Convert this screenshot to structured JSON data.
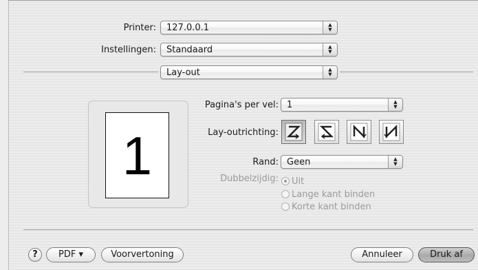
{
  "printer": {
    "label": "Printer:",
    "value": "127.0.0.1"
  },
  "settings": {
    "label": "Instellingen:",
    "value": "Standaard"
  },
  "panel": {
    "value": "Lay-out"
  },
  "preview": {
    "page_number": "1"
  },
  "pages_per_sheet": {
    "label": "Pagina's per vel:",
    "value": "1"
  },
  "layout_direction": {
    "label": "Lay-outrichting:",
    "options": [
      {
        "icon": "z-order-icon",
        "selected": true
      },
      {
        "icon": "reverse-z-order-icon",
        "selected": false
      },
      {
        "icon": "n-order-icon",
        "selected": false
      },
      {
        "icon": "reverse-n-order-icon",
        "selected": false
      }
    ]
  },
  "border": {
    "label": "Rand:",
    "value": "Geen"
  },
  "duplex": {
    "label": "Dubbelzijdig:",
    "enabled": false,
    "options": [
      {
        "label": "Uit",
        "selected": true
      },
      {
        "label": "Lange kant binden",
        "selected": false
      },
      {
        "label": "Korte kant binden",
        "selected": false
      }
    ]
  },
  "footer": {
    "help": "?",
    "pdf": "PDF ▾",
    "preview": "Voorvertoning",
    "cancel": "Annuleer",
    "print": "Druk af"
  }
}
